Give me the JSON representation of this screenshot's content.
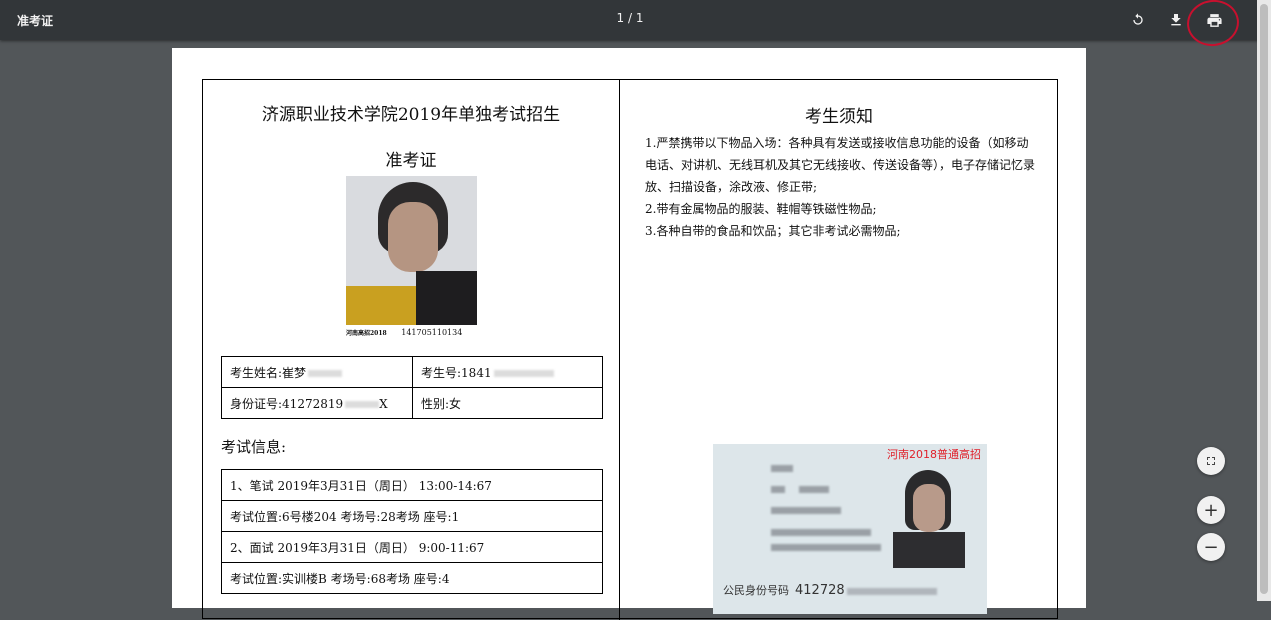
{
  "toolbar": {
    "title": "准考证",
    "page_indicator": "1 / 1"
  },
  "left": {
    "school_title": "济源职业技术学院2019年单独考试招生",
    "card_name": "准考证",
    "photo_caption_left": "河南高招2018",
    "photo_caption_number": "141705110134",
    "info": {
      "name_label": "考生姓名:崔梦",
      "exam_no_label": "考生号:1841",
      "id_label": "身份证号:41272819",
      "id_suffix": "X",
      "gender_label": "性别:女"
    },
    "exam_info_title": "考试信息:",
    "exam_rows": [
      "1、笔试  2019年3月31日（周日） 13:00-14:67",
      "考试位置:6号楼204    考场号:28考场    座号:1",
      "2、面试  2019年3月31日（周日） 9:00-11:67",
      "考试位置:实训楼B    考场号:68考场    座号:4"
    ]
  },
  "right": {
    "notice_title": "考生须知",
    "notice_items": [
      "1.严禁携带以下物品入场：各种具有发送或接收信息功能的设备（如移动电话、对讲机、无线耳机及其它无线接收、传送设备等），电子存储记忆录放、扫描设备，涂改液、修正带;",
      "2.带有金属物品的服装、鞋帽等铁磁性物品;",
      "3.各种自带的食品和饮品；其它非考试必需物品;"
    ],
    "idcard_red_text": "河南2018普通高招",
    "idcard_number_label": "公民身份号码",
    "idcard_number": "412728"
  },
  "controls": {
    "zoom_in": "+",
    "zoom_out": "−"
  }
}
